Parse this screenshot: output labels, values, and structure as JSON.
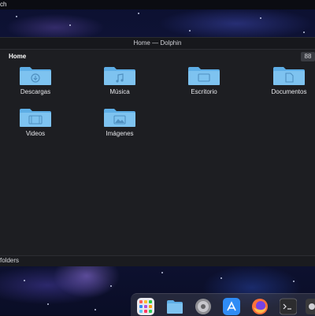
{
  "topbar": {
    "text": "ch"
  },
  "window": {
    "title": "Home — Dolphin",
    "breadcrumb": "Home",
    "view_button": "88",
    "items": [
      {
        "label": "Descargas",
        "icon": "download-icon"
      },
      {
        "label": "Música",
        "icon": "music-icon"
      },
      {
        "label": "Escritorio",
        "icon": "desktop-icon"
      },
      {
        "label": "Documentos",
        "icon": "document-icon"
      },
      {
        "label": "Videos",
        "icon": "video-icon"
      },
      {
        "label": "Imágenes",
        "icon": "image-icon"
      }
    ],
    "status": "folders"
  },
  "dock": {
    "apps": [
      "launchpad-icon",
      "files-icon",
      "settings-icon",
      "app-store-icon",
      "firefox-icon",
      "terminal-icon",
      "partial-app-icon"
    ]
  },
  "colors": {
    "folder": "#7ec3f0",
    "folder_tab": "#5eaee6",
    "window_bg": "#1d1e22",
    "firefox": "#ff7139",
    "app_store": "#2f8cf5"
  }
}
